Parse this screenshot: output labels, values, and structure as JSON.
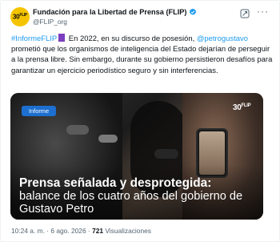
{
  "author": {
    "name": "Fundación para la Libertad de Prensa (FLIP)",
    "handle": "@FLIP_org",
    "avatar_text": "30",
    "avatar_sup": "FLIP"
  },
  "tweet": {
    "hashtag": "#InformeFLIP",
    "part1": " En 2022, en su discurso de posesión, ",
    "mention": "@petrogustavo",
    "part2": " prometió que los organismos de inteligencia del Estado dejarían de perseguir a la prensa libre. Sin embargo, durante su gobierno persistieron desafíos para garantizar un ejercicio periodístico seguro y sin interferencias."
  },
  "media": {
    "tag": "Informe",
    "logo_num": "30",
    "logo_text": "FLIP",
    "headline": "Prensa señalada y desprotegida:",
    "subline": "balance de los cuatro años del gobierno de Gustavo Petro"
  },
  "meta": {
    "time": "10:24 a. m.",
    "sep1": " · ",
    "date": "6 ago. 2026",
    "sep2": " · ",
    "views_count": "721",
    "views_label": " Visualizaciones"
  },
  "colors": {
    "link": "#1d9bf0",
    "verified": "#1d9bf0",
    "tag_bg": "#1d6fd0",
    "avatar_bg": "#f5c400"
  }
}
